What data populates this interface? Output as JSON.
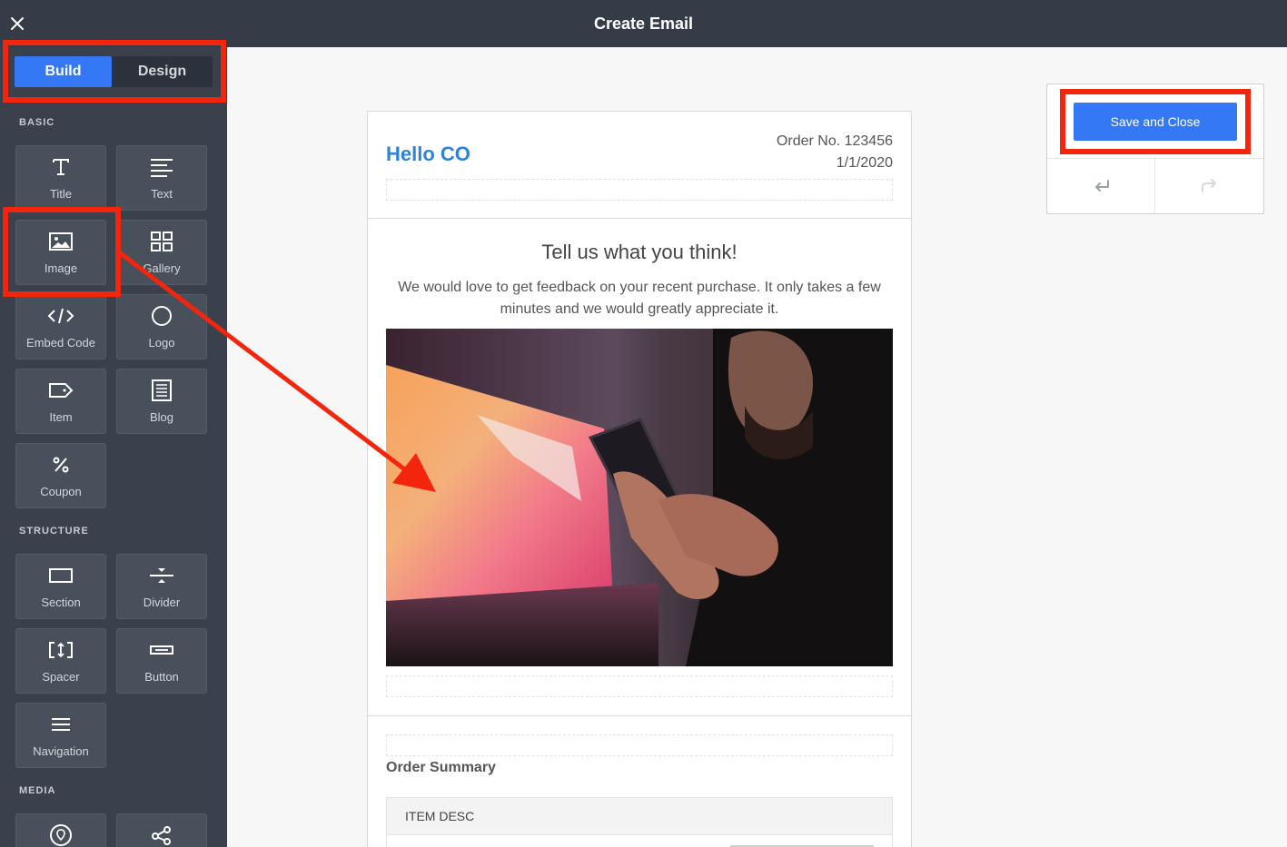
{
  "header": {
    "title": "Create Email",
    "close_icon": "close-icon"
  },
  "sidebar": {
    "tabs": {
      "build": "Build",
      "design": "Design",
      "active": "Build"
    },
    "sections": {
      "basic": "BASIC",
      "structure": "STRUCTURE",
      "media": "MEDIA"
    },
    "basic_tiles": [
      {
        "label": "Title",
        "icon": "title-icon"
      },
      {
        "label": "Text",
        "icon": "text-icon"
      },
      {
        "label": "Image",
        "icon": "image-icon"
      },
      {
        "label": "Gallery",
        "icon": "gallery-icon"
      },
      {
        "label": "Embed Code",
        "icon": "code-icon"
      },
      {
        "label": "Logo",
        "icon": "logo-icon"
      },
      {
        "label": "Item",
        "icon": "tag-icon"
      },
      {
        "label": "Blog",
        "icon": "blog-icon"
      },
      {
        "label": "Coupon",
        "icon": "percent-icon"
      }
    ],
    "structure_tiles": [
      {
        "label": "Section",
        "icon": "section-icon"
      },
      {
        "label": "Divider",
        "icon": "divider-icon"
      },
      {
        "label": "Spacer",
        "icon": "spacer-icon"
      },
      {
        "label": "Button",
        "icon": "button-icon"
      },
      {
        "label": "Navigation",
        "icon": "menu-icon"
      }
    ],
    "media_tiles": [
      {
        "icon": "map-pin-icon"
      },
      {
        "icon": "share-icon"
      }
    ]
  },
  "email": {
    "greeting": "Hello CO",
    "order_no": "Order No. 123456",
    "order_date": "1/1/2020",
    "feedback_title": "Tell us what you think!",
    "feedback_body": "We would love to get feedback on your recent purchase. It only takes a few minutes and we would greatly appreciate it.",
    "summary_title": "Order Summary",
    "table_header": "ITEM DESC"
  },
  "panel": {
    "save_label": "Save and Close",
    "undo_icon": "undo-icon",
    "redo_icon": "redo-icon"
  },
  "colors": {
    "accent": "#3478f6",
    "highlight": "#f4250d",
    "greeting": "#2d83d6",
    "topbar": "#353c47",
    "sidebar": "#3a414c"
  }
}
